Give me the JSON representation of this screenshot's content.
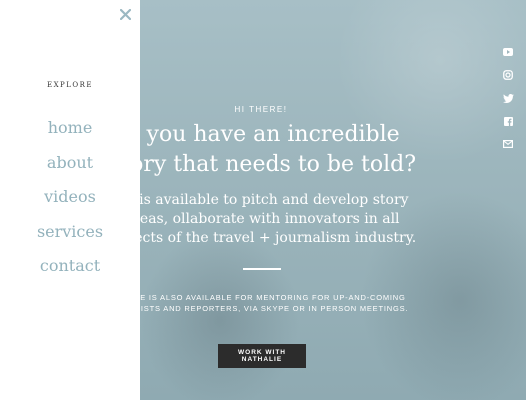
{
  "menu": {
    "heading": "EXPLORE",
    "items": [
      {
        "label": "home"
      },
      {
        "label": "about"
      },
      {
        "label": "videos"
      },
      {
        "label": "services"
      },
      {
        "label": "contact"
      }
    ],
    "close_icon": "close-icon"
  },
  "hero": {
    "eyebrow": "HI THERE!",
    "headline": "o you have an incredible story that needs to be told?",
    "subcopy": "lie is available to pitch and develop story ideas, ollaborate with innovators in all aspects of the travel + journalism industry.",
    "note": "HALIE IS ALSO AVAILABLE FOR MENTORING FOR UP-AND-COMING RNALISTS AND REPORTERS, VIA SKYPE OR IN PERSON MEETINGS.",
    "cta_label": "WORK WITH NATHALIE"
  },
  "social": [
    "youtube-icon",
    "instagram-icon",
    "twitter-icon",
    "facebook-icon",
    "email-icon"
  ],
  "colors": {
    "menu_link": "#93b2bc",
    "menu_bg": "#ffffff",
    "close": "#9bb8c2",
    "cta_bg": "#2c2c2c",
    "hero_overlay": "#9fb6bd"
  }
}
